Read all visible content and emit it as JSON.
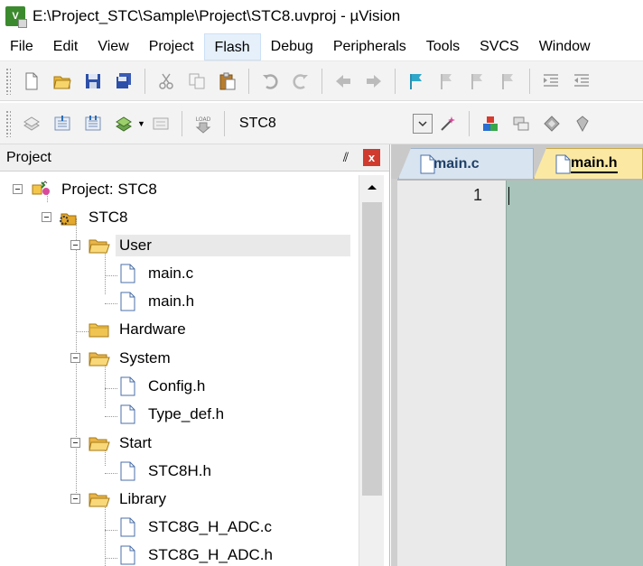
{
  "window": {
    "title": "E:\\Project_STC\\Sample\\Project\\STC8.uvproj - µVision",
    "app_icon_text": "V"
  },
  "menu": {
    "items": [
      "File",
      "Edit",
      "View",
      "Project",
      "Flash",
      "Debug",
      "Peripherals",
      "Tools",
      "SVCS",
      "Window"
    ],
    "active": "Flash"
  },
  "toolbar": {
    "target_name": "STC8",
    "load_label": "LOAD"
  },
  "project_panel": {
    "title": "Project",
    "pin_glyph": "⫽",
    "close_glyph": "x",
    "tree": [
      {
        "label": "Project: STC8",
        "type": "project"
      },
      {
        "label": "STC8",
        "type": "target"
      },
      {
        "label": "User",
        "type": "folder",
        "selected": true
      },
      {
        "label": "main.c",
        "type": "file"
      },
      {
        "label": "main.h",
        "type": "file"
      },
      {
        "label": "Hardware",
        "type": "folder"
      },
      {
        "label": "System",
        "type": "folder"
      },
      {
        "label": "Config.h",
        "type": "file"
      },
      {
        "label": "Type_def.h",
        "type": "file"
      },
      {
        "label": "Start",
        "type": "folder"
      },
      {
        "label": "STC8H.h",
        "type": "file"
      },
      {
        "label": "Library",
        "type": "folder"
      },
      {
        "label": "STC8G_H_ADC.c",
        "type": "file"
      },
      {
        "label": "STC8G_H_ADC.h",
        "type": "file"
      }
    ]
  },
  "editor": {
    "tabs": [
      {
        "label": "main.c",
        "active": false
      },
      {
        "label": "main.h",
        "active": true
      }
    ],
    "line_numbers": [
      "1"
    ]
  },
  "colors": {
    "editor_background": "#a8c4bb",
    "active_tab": "#fbe9a3",
    "close_button": "#d03b2f"
  }
}
